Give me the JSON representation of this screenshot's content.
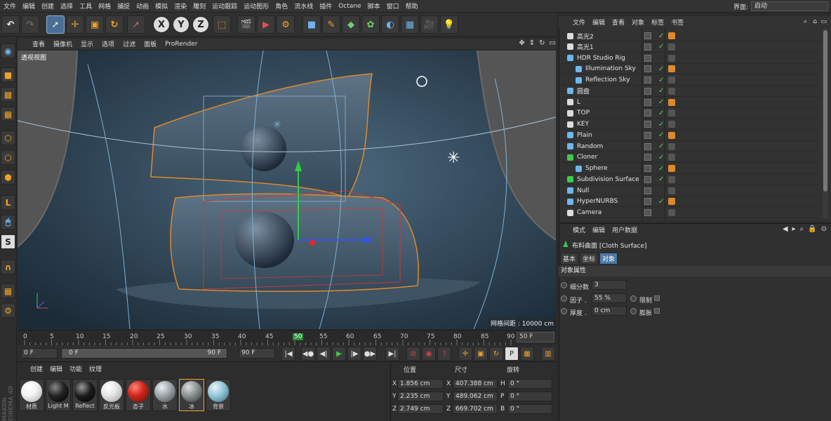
{
  "menubar": {
    "items": [
      "文件",
      "编辑",
      "创建",
      "选择",
      "工具",
      "网格",
      "捕捉",
      "动画",
      "模拟",
      "渲染",
      "雕刻",
      "运动跟踪",
      "运动图形",
      "角色",
      "流水线",
      "插件",
      "Octane",
      "脚本",
      "窗口",
      "帮助"
    ],
    "layout_label": "界面:",
    "layout_value": "启动"
  },
  "toolbar": {
    "undo_icon": "undo-icon",
    "redo_icon": "redo-icon",
    "axis_x": "X",
    "axis_y": "Y",
    "axis_z": "Z"
  },
  "viewport": {
    "menu": [
      "查看",
      "摄像机",
      "显示",
      "选项",
      "过滤",
      "面板",
      "ProRender"
    ],
    "view_label": "透视视图",
    "grid_spacing": "网格间距 : 10000 cm"
  },
  "timeline": {
    "ticks": [
      "0",
      "5",
      "10",
      "15",
      "20",
      "25",
      "30",
      "35",
      "40",
      "45",
      "50",
      "55",
      "60",
      "65",
      "70",
      "75",
      "80",
      "85",
      "90"
    ],
    "current_frame": "50",
    "end_frame_display": "50 F"
  },
  "playback": {
    "start": "0 F",
    "range_start": "0 F",
    "range_end": "90 F",
    "end": "90 F"
  },
  "materials": {
    "menu": [
      "创建",
      "编辑",
      "功能",
      "纹理"
    ],
    "items": [
      {
        "name": "材质",
        "color": "#f4f4f4"
      },
      {
        "name": "Light M",
        "color": "#222222"
      },
      {
        "name": "Reflect",
        "color": "#1d1d1d"
      },
      {
        "name": "反光板",
        "color": "#e8e8e8"
      },
      {
        "name": "杏子",
        "color": "#d42a1e"
      },
      {
        "name": "水",
        "color": "#9aa4aa"
      },
      {
        "name": "冰",
        "color": "#8a8f90"
      },
      {
        "name": "背景",
        "color": "#8fc4d4"
      }
    ]
  },
  "coords": {
    "headers": [
      "位置",
      "尺寸",
      "旋转"
    ],
    "rows": [
      {
        "axis": "X",
        "pos": "1.856 cm",
        "size_axis": "X",
        "size": "407.388 cm",
        "rot_axis": "H",
        "rot": "0 °"
      },
      {
        "axis": "Y",
        "pos": "2.235 cm",
        "size_axis": "Y",
        "size": "489.062 cm",
        "rot_axis": "P",
        "rot": "0 °"
      },
      {
        "axis": "Z",
        "pos": "2.749 cm",
        "size_axis": "Z",
        "size": "669.702 cm",
        "rot_axis": "B",
        "rot": "0 °"
      }
    ]
  },
  "objects": {
    "menu": [
      "文件",
      "编辑",
      "查看",
      "对象",
      "标签",
      "书签"
    ],
    "rows": [
      {
        "name": "高光2",
        "icon": "light-icon",
        "checked": true
      },
      {
        "name": "高光1",
        "icon": "light-icon",
        "checked": true
      },
      {
        "name": "HDR Studio Rig",
        "icon": "null-icon",
        "checked": false
      },
      {
        "name": "Illumination Sky",
        "icon": "sky-icon",
        "checked": true
      },
      {
        "name": "Reflection Sky",
        "icon": "sky-icon",
        "checked": true
      },
      {
        "name": "圆盘",
        "icon": "disc-icon",
        "checked": true
      },
      {
        "name": "L",
        "icon": "light-icon",
        "checked": true
      },
      {
        "name": "TOP",
        "icon": "light-icon",
        "checked": true
      },
      {
        "name": "KEY",
        "icon": "light-icon",
        "checked": true
      },
      {
        "name": "Plain",
        "icon": "plain-icon",
        "checked": true
      },
      {
        "name": "Random",
        "icon": "random-icon",
        "checked": true
      },
      {
        "name": "Cloner",
        "icon": "cloner-icon",
        "checked": true
      },
      {
        "name": "Sphere",
        "icon": "sphere-icon",
        "checked": true
      },
      {
        "name": "Subdivision Surface",
        "icon": "subdiv-icon",
        "checked": true
      },
      {
        "name": "Null",
        "icon": "null-icon",
        "checked": false
      },
      {
        "name": "HyperNURBS",
        "icon": "hypernurbs-icon",
        "checked": true
      },
      {
        "name": "Camera",
        "icon": "camera-icon",
        "checked": false
      }
    ]
  },
  "attributes": {
    "menu": [
      "模式",
      "编辑",
      "用户数据"
    ],
    "title": "布料曲面 [Cloth Surface]",
    "tabs": [
      "基本",
      "坐标",
      "对象"
    ],
    "section": "对象属性",
    "props": [
      {
        "label": "细分数",
        "value": "3"
      },
      {
        "label": "因子 .",
        "value": "55 %"
      },
      {
        "label": "厚度 .",
        "value": "0 cm"
      }
    ],
    "limit_label": "限制",
    "expand_label": "膨胀"
  },
  "brand": "MAXON CINEMA 4D"
}
